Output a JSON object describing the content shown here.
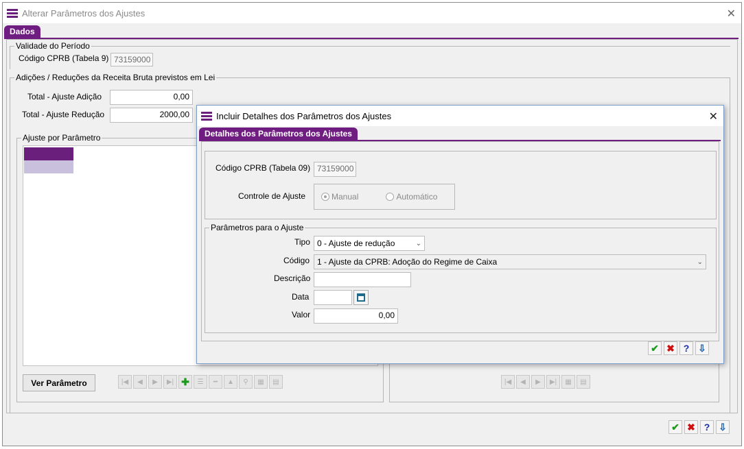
{
  "window": {
    "title": "Alterar Parâmetros dos Ajustes",
    "close_label": "✕"
  },
  "tab": {
    "label": "Dados"
  },
  "periodo": {
    "legend": "Validade do Período",
    "codigo_label": "Código CPRB (Tabela 9)",
    "codigo_value": "73159000"
  },
  "adicoes": {
    "legend": "Adições / Reduções da Receita Bruta previstos em Lei",
    "adicao_label": "Total - Ajuste Adição",
    "adicao_value": "0,00",
    "reducao_label": "Total - Ajuste Redução",
    "reducao_value": "2000,00"
  },
  "ajuste": {
    "legend": "Ajuste por Parâmetro",
    "ver_button": "Ver Parâmetro"
  },
  "nav_icons": [
    "first-icon",
    "prev-icon",
    "next-icon",
    "last-icon",
    "add-icon",
    "edit-icon",
    "remove-icon",
    "up-icon",
    "search-icon",
    "grid-icon",
    "export-icon"
  ],
  "actions": {
    "ok": "✔",
    "cancel": "✖",
    "help": "?",
    "exit": "⇩"
  },
  "dialog": {
    "title": "Incluir Detalhes dos Parâmetros dos Ajustes",
    "tab": "Detalhes dos Parâmetros dos Ajustes",
    "codigo_label": "Código CPRB (Tabela 09)",
    "codigo_value": "73159000",
    "controle_label": "Controle de Ajuste",
    "manual_label": "Manual",
    "automatico_label": "Automático",
    "param_legend": "Parâmetros para o Ajuste",
    "tipo_label": "Tipo",
    "tipo_value": "0 - Ajuste de redução",
    "codigo2_label": "Código",
    "codigo2_value": "1 - Ajuste da CPRB: Adoção do Regime de Caixa",
    "descricao_label": "Descrição",
    "descricao_value": "",
    "data_label": "Data",
    "data_value": "",
    "valor_label": "Valor",
    "valor_value": "0,00"
  },
  "colors": {
    "accent": "#701d82",
    "list_selected": "#6b1f7c",
    "list_second": "#c9c0de"
  }
}
